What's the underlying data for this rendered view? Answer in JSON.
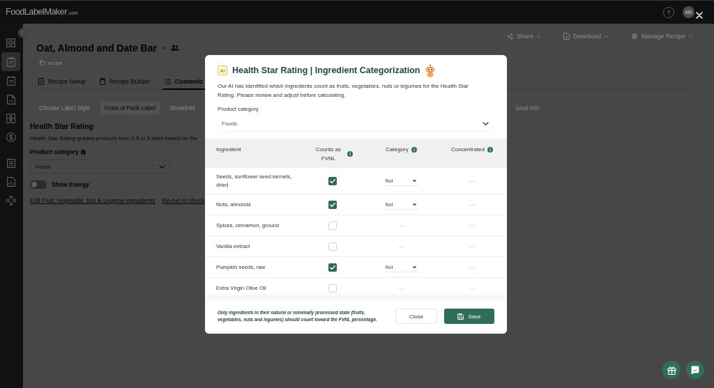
{
  "top_bar": {
    "logo": "FoodLabelMaker",
    "logo_suffix": ".com",
    "help": "?",
    "avatar": "MS"
  },
  "sidebar": {
    "groups": [
      [
        {
          "kind": "grid",
          "selected": false
        },
        {
          "kind": "clipboard",
          "selected": true
        },
        {
          "kind": "notepad",
          "selected": false
        },
        {
          "kind": "page",
          "selected": false
        },
        {
          "kind": "columns",
          "selected": false
        },
        {
          "kind": "dollar",
          "selected": false
        }
      ],
      [
        {
          "kind": "list",
          "selected": false
        },
        {
          "kind": "report",
          "selected": false
        },
        {
          "kind": "network",
          "selected": false
        }
      ]
    ]
  },
  "toolbar": [
    {
      "kind": "share",
      "label": "Share"
    },
    {
      "kind": "download",
      "label": "Download"
    },
    {
      "kind": "settings",
      "label": "Manage Recipe"
    }
  ],
  "recipe": {
    "title": "Oat, Almond and Date Bar",
    "type": "recipe"
  },
  "tabs": [
    {
      "kind": "setup",
      "label": "Recipe Setup",
      "selected": false
    },
    {
      "kind": "builder",
      "label": "Recipe Builder",
      "selected": false
    },
    {
      "kind": "customize",
      "label": "Customiz",
      "selected": true
    }
  ],
  "sub_tabs": [
    {
      "label": "Choose Label Style",
      "selected": false
    },
    {
      "label": "Front of Pack Label",
      "selected": true
    },
    {
      "label": "Show/Hid",
      "selected": false
    },
    {
      "label": "ional Info",
      "selected": false
    }
  ],
  "section": {
    "heading": "Health Star Rating",
    "description": "Health Star Rating grades products from 0.5 to 5 stars based on the",
    "category_label": "Product category",
    "category_value": "Foods",
    "toggle": {
      "label": "Show Energy",
      "on": false
    },
    "links": [
      "Edit Fruit, Vegetable, Nut & Legume ingredients",
      "Re-run AI check"
    ]
  },
  "modal": {
    "ai_badge": "Ai",
    "title": "Health Star Rating | Ingredient Categorization",
    "description": "Our AI has identified which ingredients count as fruits, vegetables, nuts or legumes for the Health Star Rating. Please review and adjust before calculating.",
    "category_label": "Product category",
    "category_value": "Foods",
    "table": {
      "columns": [
        {
          "label": "Ingredient",
          "info": false
        },
        {
          "label": "Counts as FVNL",
          "info": true
        },
        {
          "label": "Category",
          "info": true
        },
        {
          "label": "Concentrated",
          "info": true
        }
      ],
      "rows": [
        {
          "ingredient": "Seeds, sunflower seed kernels, dried",
          "checked": true,
          "category": {
            "kind": "select",
            "value": "Nut"
          },
          "concentrated": "—"
        },
        {
          "ingredient": "Nuts, almonds",
          "checked": true,
          "category": {
            "kind": "select",
            "value": "Nut"
          },
          "concentrated": "—"
        },
        {
          "ingredient": "Spices, cinnamon, ground",
          "checked": false,
          "category": {
            "kind": "text",
            "value": "—"
          },
          "concentrated": "—"
        },
        {
          "ingredient": "Vanilla extract",
          "checked": false,
          "category": {
            "kind": "text",
            "value": "—"
          },
          "concentrated": "—"
        },
        {
          "ingredient": "Pumpkin seeds, raw",
          "checked": true,
          "category": {
            "kind": "select",
            "value": "Nut"
          },
          "concentrated": "—"
        },
        {
          "ingredient": "Extra Virgin Olive Oil",
          "checked": false,
          "category": {
            "kind": "text",
            "value": "—"
          },
          "concentrated": "—"
        }
      ]
    },
    "footnote": "Only ingredients in their natural or minimally processed state (fruits, vegetables, nuts and legumes) should count toward the FVNL percentage.",
    "buttons": [
      {
        "kind": "secondary",
        "label": "Close"
      },
      {
        "kind": "primary",
        "label": "Save"
      }
    ]
  }
}
